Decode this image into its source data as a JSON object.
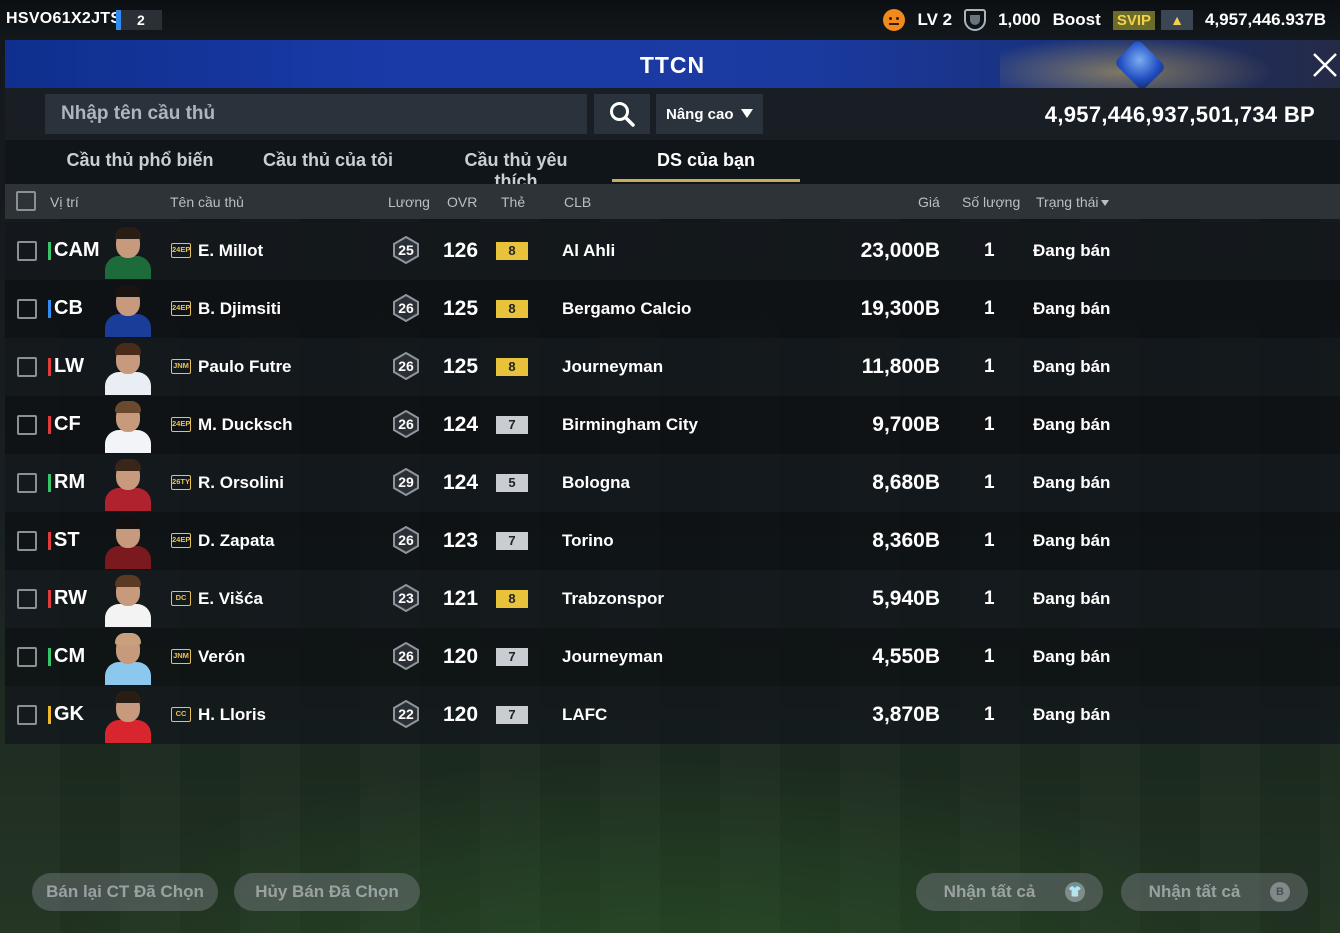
{
  "topbar": {
    "user_id": "HSVO61X2JTS",
    "level_badge": "2",
    "lv_label": "LV 2",
    "points": "1,000",
    "boost_label": "Boost",
    "svip_label": "SVIP",
    "coins": "4,957,446.937B"
  },
  "title": "TTCN",
  "search": {
    "placeholder": "Nhập tên cầu thủ",
    "value": "",
    "advanced_label": "Nâng cao"
  },
  "bp_total": "4,957,446,937,501,734 BP",
  "tabs": [
    {
      "label": "Cầu thủ phổ biến",
      "active": false
    },
    {
      "label": "Cầu thủ của tôi",
      "active": false
    },
    {
      "label": "Cầu thủ yêu thích",
      "active": false
    },
    {
      "label": "DS của bạn",
      "active": true
    }
  ],
  "columns": {
    "position": "Vị trí",
    "player": "Tên cầu thủ",
    "wage": "Lương",
    "ovr": "OVR",
    "card": "Thẻ",
    "club": "CLB",
    "price": "Giá",
    "quantity": "Số lượng",
    "status": "Trạng thái"
  },
  "colors": {
    "accent_gold": "#c9ad5f",
    "pos_attack": "#e23a3a",
    "pos_mid": "#39c46a",
    "pos_def": "#2f8cf0",
    "pos_gk": "#f0b828",
    "card_gold": "#e8c23a",
    "card_silver": "#c9ccd0"
  },
  "rows": [
    {
      "position": "CAM",
      "pos_color": "#39c46a",
      "season": "24EP",
      "name": "E. Millot",
      "wage": "25",
      "ovr": "126",
      "card": "8",
      "card_color": "#e8c23a",
      "club": "Al Ahli",
      "price": "23,000B",
      "qty": "1",
      "status": "Đang bán",
      "shirt": "#1d6b3a",
      "hair": "#2a1d14"
    },
    {
      "position": "CB",
      "pos_color": "#2f8cf0",
      "season": "24EP",
      "name": "B. Djimsiti",
      "wage": "26",
      "ovr": "125",
      "card": "8",
      "card_color": "#e8c23a",
      "club": "Bergamo Calcio",
      "price": "19,300B",
      "qty": "1",
      "status": "Đang bán",
      "shirt": "#1a3d9a",
      "hair": "#1a1410"
    },
    {
      "position": "LW",
      "pos_color": "#e23a3a",
      "season": "JNM",
      "name": "Paulo Futre",
      "wage": "26",
      "ovr": "125",
      "card": "8",
      "card_color": "#e8c23a",
      "club": "Journeyman",
      "price": "11,800B",
      "qty": "1",
      "status": "Đang bán",
      "shirt": "#e9eef5",
      "hair": "#4a2a18"
    },
    {
      "position": "CF",
      "pos_color": "#e23a3a",
      "season": "24EP",
      "name": "M. Ducksch",
      "wage": "26",
      "ovr": "124",
      "card": "7",
      "card_color": "#c9ccd0",
      "club": "Birmingham City",
      "price": "9,700B",
      "qty": "1",
      "status": "Đang bán",
      "shirt": "#f2f4f8",
      "hair": "#6a4a2e"
    },
    {
      "position": "RM",
      "pos_color": "#39c46a",
      "season": "26TY",
      "name": "R. Orsolini",
      "wage": "29",
      "ovr": "124",
      "card": "5",
      "card_color": "#c9ccd0",
      "club": "Bologna",
      "price": "8,680B",
      "qty": "1",
      "status": "Đang bán",
      "shirt": "#b0222e",
      "hair": "#3a2618"
    },
    {
      "position": "ST",
      "pos_color": "#e23a3a",
      "season": "24EP",
      "name": "D. Zapata",
      "wage": "26",
      "ovr": "123",
      "card": "7",
      "card_color": "#c9ccd0",
      "club": "Torino",
      "price": "8,360B",
      "qty": "1",
      "status": "Đang bán",
      "shirt": "#7a1a1e",
      "hair": "#151010"
    },
    {
      "position": "RW",
      "pos_color": "#e23a3a",
      "season": "DC",
      "name": "E. Višća",
      "wage": "23",
      "ovr": "121",
      "card": "8",
      "card_color": "#e8c23a",
      "club": "Trabzonspor",
      "price": "5,940B",
      "qty": "1",
      "status": "Đang bán",
      "shirt": "#f3f3f3",
      "hair": "#5a3a22"
    },
    {
      "position": "CM",
      "pos_color": "#39c46a",
      "season": "JNM",
      "name": "Verón",
      "wage": "26",
      "ovr": "120",
      "card": "7",
      "card_color": "#c9ccd0",
      "club": "Journeyman",
      "price": "4,550B",
      "qty": "1",
      "status": "Đang bán",
      "shirt": "#8cc8ee",
      "hair": "#c9a07e"
    },
    {
      "position": "GK",
      "pos_color": "#f0b828",
      "season": "CC",
      "name": "H. Lloris",
      "wage": "22",
      "ovr": "120",
      "card": "7",
      "card_color": "#c9ccd0",
      "club": "LAFC",
      "price": "3,870B",
      "qty": "1",
      "status": "Đang bán",
      "shirt": "#d9262e",
      "hair": "#2a1d14"
    }
  ],
  "bottom_buttons": {
    "resell_selected": "Bán lại CT Đã Chọn",
    "cancel_selected": "Hủy Bán Đã Chọn",
    "receive_all_1": "Nhận tất cả",
    "receive_all_2": "Nhận tất cả"
  }
}
